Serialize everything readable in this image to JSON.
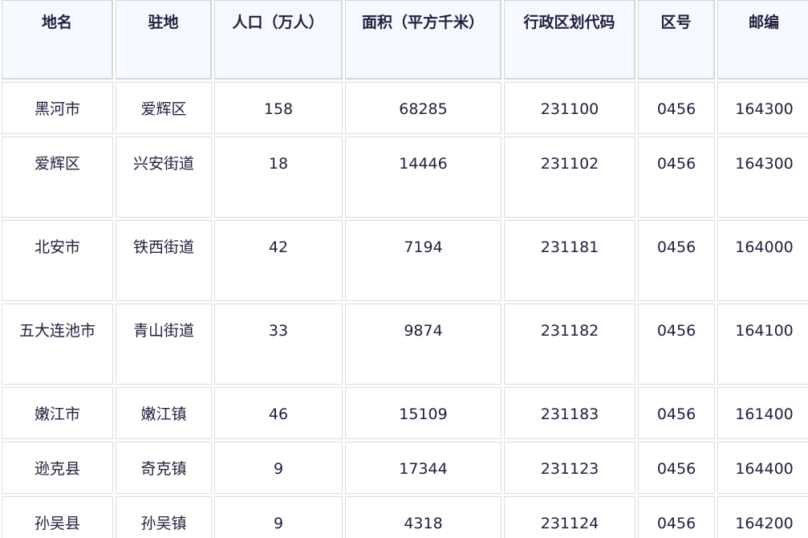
{
  "table": {
    "headers": [
      "地名",
      "驻地",
      "人口（万人）",
      "面积（平方千米）",
      "行政区划代码",
      "区号",
      "邮编"
    ],
    "rows": [
      [
        "黑河市",
        "爱辉区",
        "158",
        "68285",
        "231100",
        "0456",
        "164300"
      ],
      [
        "爱辉区",
        "兴安街道",
        "18",
        "14446",
        "231102",
        "0456",
        "164300"
      ],
      [
        "北安市",
        "铁西街道",
        "42",
        "7194",
        "231181",
        "0456",
        "164000"
      ],
      [
        "五大连池市",
        "青山街道",
        "33",
        "9874",
        "231182",
        "0456",
        "164100"
      ],
      [
        "嫩江市",
        "嫩江镇",
        "46",
        "15109",
        "231183",
        "0456",
        "161400"
      ],
      [
        "逊克县",
        "奇克镇",
        "9",
        "17344",
        "231123",
        "0456",
        "164400"
      ],
      [
        "孙吴县",
        "孙吴镇",
        "9",
        "4318",
        "231124",
        "0456",
        "164200"
      ]
    ]
  }
}
